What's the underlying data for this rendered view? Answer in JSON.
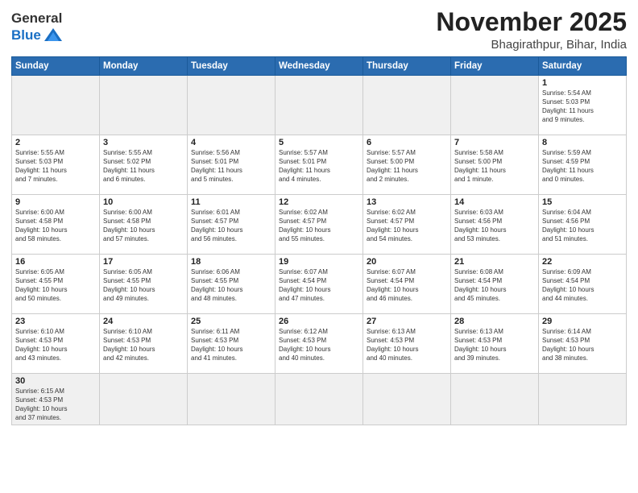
{
  "header": {
    "logo_general": "General",
    "logo_blue": "Blue",
    "month": "November 2025",
    "location": "Bhagirathpur, Bihar, India"
  },
  "days_of_week": [
    "Sunday",
    "Monday",
    "Tuesday",
    "Wednesday",
    "Thursday",
    "Friday",
    "Saturday"
  ],
  "weeks": [
    [
      {
        "day": "",
        "info": ""
      },
      {
        "day": "",
        "info": ""
      },
      {
        "day": "",
        "info": ""
      },
      {
        "day": "",
        "info": ""
      },
      {
        "day": "",
        "info": ""
      },
      {
        "day": "",
        "info": ""
      },
      {
        "day": "1",
        "info": "Sunrise: 5:54 AM\nSunset: 5:03 PM\nDaylight: 11 hours\nand 9 minutes."
      }
    ],
    [
      {
        "day": "2",
        "info": "Sunrise: 5:55 AM\nSunset: 5:03 PM\nDaylight: 11 hours\nand 7 minutes."
      },
      {
        "day": "3",
        "info": "Sunrise: 5:55 AM\nSunset: 5:02 PM\nDaylight: 11 hours\nand 6 minutes."
      },
      {
        "day": "4",
        "info": "Sunrise: 5:56 AM\nSunset: 5:01 PM\nDaylight: 11 hours\nand 5 minutes."
      },
      {
        "day": "5",
        "info": "Sunrise: 5:57 AM\nSunset: 5:01 PM\nDaylight: 11 hours\nand 4 minutes."
      },
      {
        "day": "6",
        "info": "Sunrise: 5:57 AM\nSunset: 5:00 PM\nDaylight: 11 hours\nand 2 minutes."
      },
      {
        "day": "7",
        "info": "Sunrise: 5:58 AM\nSunset: 5:00 PM\nDaylight: 11 hours\nand 1 minute."
      },
      {
        "day": "8",
        "info": "Sunrise: 5:59 AM\nSunset: 4:59 PM\nDaylight: 11 hours\nand 0 minutes."
      }
    ],
    [
      {
        "day": "9",
        "info": "Sunrise: 6:00 AM\nSunset: 4:58 PM\nDaylight: 10 hours\nand 58 minutes."
      },
      {
        "day": "10",
        "info": "Sunrise: 6:00 AM\nSunset: 4:58 PM\nDaylight: 10 hours\nand 57 minutes."
      },
      {
        "day": "11",
        "info": "Sunrise: 6:01 AM\nSunset: 4:57 PM\nDaylight: 10 hours\nand 56 minutes."
      },
      {
        "day": "12",
        "info": "Sunrise: 6:02 AM\nSunset: 4:57 PM\nDaylight: 10 hours\nand 55 minutes."
      },
      {
        "day": "13",
        "info": "Sunrise: 6:02 AM\nSunset: 4:57 PM\nDaylight: 10 hours\nand 54 minutes."
      },
      {
        "day": "14",
        "info": "Sunrise: 6:03 AM\nSunset: 4:56 PM\nDaylight: 10 hours\nand 53 minutes."
      },
      {
        "day": "15",
        "info": "Sunrise: 6:04 AM\nSunset: 4:56 PM\nDaylight: 10 hours\nand 51 minutes."
      }
    ],
    [
      {
        "day": "16",
        "info": "Sunrise: 6:05 AM\nSunset: 4:55 PM\nDaylight: 10 hours\nand 50 minutes."
      },
      {
        "day": "17",
        "info": "Sunrise: 6:05 AM\nSunset: 4:55 PM\nDaylight: 10 hours\nand 49 minutes."
      },
      {
        "day": "18",
        "info": "Sunrise: 6:06 AM\nSunset: 4:55 PM\nDaylight: 10 hours\nand 48 minutes."
      },
      {
        "day": "19",
        "info": "Sunrise: 6:07 AM\nSunset: 4:54 PM\nDaylight: 10 hours\nand 47 minutes."
      },
      {
        "day": "20",
        "info": "Sunrise: 6:07 AM\nSunset: 4:54 PM\nDaylight: 10 hours\nand 46 minutes."
      },
      {
        "day": "21",
        "info": "Sunrise: 6:08 AM\nSunset: 4:54 PM\nDaylight: 10 hours\nand 45 minutes."
      },
      {
        "day": "22",
        "info": "Sunrise: 6:09 AM\nSunset: 4:54 PM\nDaylight: 10 hours\nand 44 minutes."
      }
    ],
    [
      {
        "day": "23",
        "info": "Sunrise: 6:10 AM\nSunset: 4:53 PM\nDaylight: 10 hours\nand 43 minutes."
      },
      {
        "day": "24",
        "info": "Sunrise: 6:10 AM\nSunset: 4:53 PM\nDaylight: 10 hours\nand 42 minutes."
      },
      {
        "day": "25",
        "info": "Sunrise: 6:11 AM\nSunset: 4:53 PM\nDaylight: 10 hours\nand 41 minutes."
      },
      {
        "day": "26",
        "info": "Sunrise: 6:12 AM\nSunset: 4:53 PM\nDaylight: 10 hours\nand 40 minutes."
      },
      {
        "day": "27",
        "info": "Sunrise: 6:13 AM\nSunset: 4:53 PM\nDaylight: 10 hours\nand 40 minutes."
      },
      {
        "day": "28",
        "info": "Sunrise: 6:13 AM\nSunset: 4:53 PM\nDaylight: 10 hours\nand 39 minutes."
      },
      {
        "day": "29",
        "info": "Sunrise: 6:14 AM\nSunset: 4:53 PM\nDaylight: 10 hours\nand 38 minutes."
      }
    ],
    [
      {
        "day": "30",
        "info": "Sunrise: 6:15 AM\nSunset: 4:53 PM\nDaylight: 10 hours\nand 37 minutes."
      },
      {
        "day": "",
        "info": ""
      },
      {
        "day": "",
        "info": ""
      },
      {
        "day": "",
        "info": ""
      },
      {
        "day": "",
        "info": ""
      },
      {
        "day": "",
        "info": ""
      },
      {
        "day": "",
        "info": ""
      }
    ]
  ]
}
